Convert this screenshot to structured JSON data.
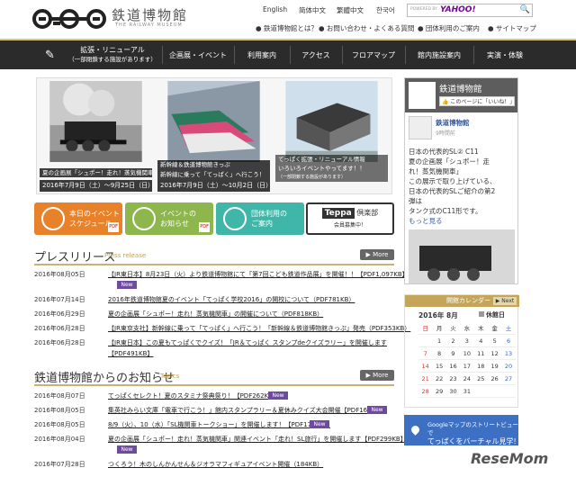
{
  "header": {
    "logo_title": "鉄道博物館",
    "logo_sub": "THE RAILWAY MUSEUM",
    "langs": [
      "English",
      "简体中文",
      "繁體中文",
      "한국어"
    ],
    "search_powered": "POWERED BY",
    "search_brand": "YAHOO!",
    "search_glyph": "🔍",
    "links": [
      "● 鉄道博物館とは？",
      "● お問い合わせ・よくある質問",
      "● 団体利用のご案内",
      "● サイトマップ"
    ]
  },
  "nav": {
    "first_label": "拡張・リニューアル",
    "first_sub": "（一部閉鎖する施設があります）",
    "items": [
      "企画展・イベント",
      "利用案内",
      "アクセス",
      "フロアマップ",
      "館内施設案内",
      "実演・体験"
    ]
  },
  "banners": [
    {
      "cap": [
        "夏の企画展「シュポー！走れ！蒸気機関車」開催"
      ],
      "date": "2016年7月9日（土）～9月25日（日）"
    },
    {
      "cap": [
        "新幹線＆鉄道博物館きっぷ",
        "新幹線に乗って「てっぱく」へ行こう！"
      ],
      "date": "2016年7月9日（土）～10月2日（日）"
    },
    {
      "cap": [
        "てっぱく拡張・リニューアル情報",
        "いろいろイベントやってます！！",
        "（一部閉鎖する施設があります）"
      ],
      "date": ""
    }
  ],
  "quick": [
    {
      "label": [
        "本日のイベント",
        "スケジュール"
      ],
      "color": "#e8822a",
      "pdf": "PDF"
    },
    {
      "label": [
        "イベントの",
        "お知らせ"
      ],
      "color": "#8db64c",
      "pdf": "PDF"
    },
    {
      "label": [
        "団体利用の",
        "ご案内"
      ],
      "color": "#3fb6a8",
      "pdf": ""
    },
    {
      "teppa": "Teppa",
      "club": "倶楽部",
      "sub": "会員募集中！"
    }
  ],
  "press": {
    "title": "プレスリリース",
    "sub": "Press release",
    "more": "▶ More",
    "items": [
      {
        "date": "2016年08月05日",
        "text": "【JR東日本】8月23日（火）より鉄道博物館にて「第7回こども鉄道作品展」を開催！！【PDF1,097KB】",
        "new": "New"
      },
      {
        "date": "2016年07月14日",
        "text": "2016年鉄道博物館夏のイベント「てっぱく学校2016」の開校について（PDF781KB）",
        "new": ""
      },
      {
        "date": "2016年06月29日",
        "text": "夏の企画展「シュポー！走れ！蒸気機関車」の開催について（PDF818KB）",
        "new": ""
      },
      {
        "date": "2016年06月28日",
        "text": "【JR東京支社】新幹線に乗って「てっぱく」へ行こう！「新幹線＆鉄道博物館きっぷ」発売（PDF353KB）",
        "new": ""
      },
      {
        "date": "2016年06月28日",
        "text": "【JR東日本】この夏もてっぱくでクイズ！「JR＆てっぱく スタンプdeクイズラリー」を開催します",
        "text2": "【PDF491KB】",
        "new": ""
      }
    ]
  },
  "notice": {
    "title": "鉄道博物館からのお知らせ",
    "sub": "Topics",
    "more": "▶ More",
    "items": [
      {
        "date": "2016年08月07日",
        "text": "てっぱくセレクト！夏のスタミナ祭典祭り！【PDF262KB】",
        "new": "New"
      },
      {
        "date": "2016年08月05日",
        "text": "集英社みらい文庫「電車で行こう！」館内スタンプラリー＆夏休みクイズ大会開催【PDF165KB】",
        "new": "New"
      },
      {
        "date": "2016年08月05日",
        "text": "8/9（火）、10（水）「SL機関車トークショー」を開催します！【PDF176KB】",
        "new": "New"
      },
      {
        "date": "2016年08月04日",
        "text": "夏の企画展「シュポー！走れ！蒸気機関車」関連イベント「走れ！SL旅行」を開催します【PDF299KB】",
        "new": "New"
      },
      {
        "date": "2016年07月28日",
        "text": "つくろう！木のしんかんせん＆ジオラマフィギュアイベント開催（184KB）",
        "new": ""
      }
    ]
  },
  "facebook": {
    "name": "鉄道博物館",
    "like": "👍 このページに「いいね！」",
    "poster": "鉄道博物館",
    "time": "9時間前",
    "body": [
      "日本の代表的SL② C11",
      "夏の企画展「シュポー！走",
      "れ！蒸気機関車」",
      "この展示で取り上げている、",
      "日本の代表的SLご紹介の第2",
      "弾は",
      "タンク式のC11形です。",
      "もっと見る"
    ]
  },
  "calendar": {
    "title": "開館カレンダー",
    "next": "▶ Next",
    "month": "2016年 8月",
    "holiday": "休館日",
    "weekdays": [
      "日",
      "月",
      "火",
      "水",
      "木",
      "金",
      "土"
    ],
    "weeks": [
      [
        "",
        "1",
        "2",
        "3",
        "4",
        "5",
        "6"
      ],
      [
        "7",
        "8",
        "9",
        "10",
        "11",
        "12",
        "13"
      ],
      [
        "14",
        "15",
        "16",
        "17",
        "18",
        "19",
        "20"
      ],
      [
        "21",
        "22",
        "23",
        "24",
        "25",
        "26",
        "27"
      ],
      [
        "28",
        "29",
        "30",
        "31",
        "",
        "",
        ""
      ]
    ]
  },
  "gmap": {
    "line1": "Googleマップのストリートビューで",
    "line2": "てっぱくをバーチャル見学!"
  },
  "watermark": "ReseMom"
}
